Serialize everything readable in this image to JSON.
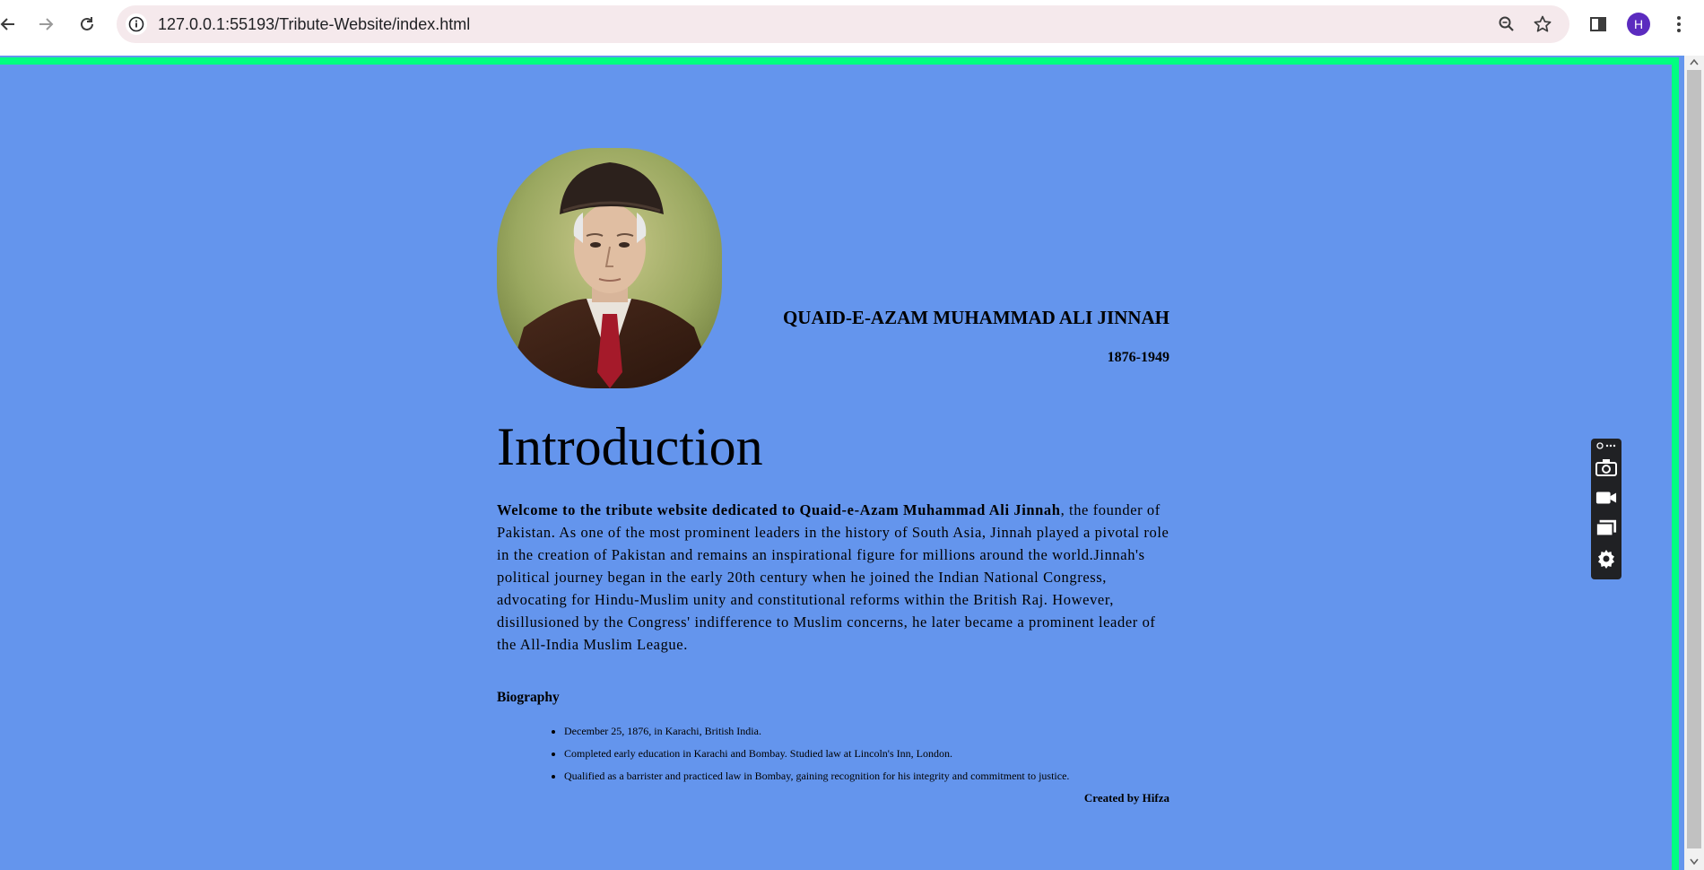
{
  "browser": {
    "url": "127.0.0.1:55193/Tribute-Website/index.html",
    "profile_initial": "H",
    "icons": [
      "back-icon",
      "forward-icon",
      "reload-icon",
      "site-info-icon",
      "zoom-icon",
      "bookmark-star-icon",
      "side-panel-icon",
      "kebab-menu-icon"
    ]
  },
  "page": {
    "header": {
      "name": "QUAID-E-AZAM MUHAMMAD ALI JINNAH",
      "years": "1876-1949"
    },
    "intro": {
      "title": "Introduction",
      "lead_bold": "Welcome to the tribute website dedicated to Quaid-e-Azam Muhammad Ali Jinnah",
      "body": ", the founder of Pakistan. As one of the most prominent leaders in the history of South Asia, Jinnah played a pivotal role in the creation of Pakistan and remains an inspirational figure for millions around the world.Jinnah's political journey began in the early 20th century when he joined the Indian National Congress, advocating for Hindu-Muslim unity and constitutional reforms within the British Raj. However, disillusioned by the Congress' indifference to Muslim concerns, he later became a prominent leader of the All-India Muslim League."
    },
    "biography": {
      "heading": "Biography",
      "items": [
        "December 25, 1876, in Karachi, British India.",
        "Completed early education in Karachi and Bombay. Studied law at Lincoln's Inn, London.",
        "Qualified as a barrister and practiced law in Bombay, gaining recognition for his integrity and commitment to justice."
      ]
    },
    "credit": "Created by Hifza"
  },
  "colors": {
    "page_background": "#6495ed",
    "border_accent": "#00ff80",
    "omnibox_background": "#f5e9ec",
    "avatar": "#5b2bbf"
  }
}
